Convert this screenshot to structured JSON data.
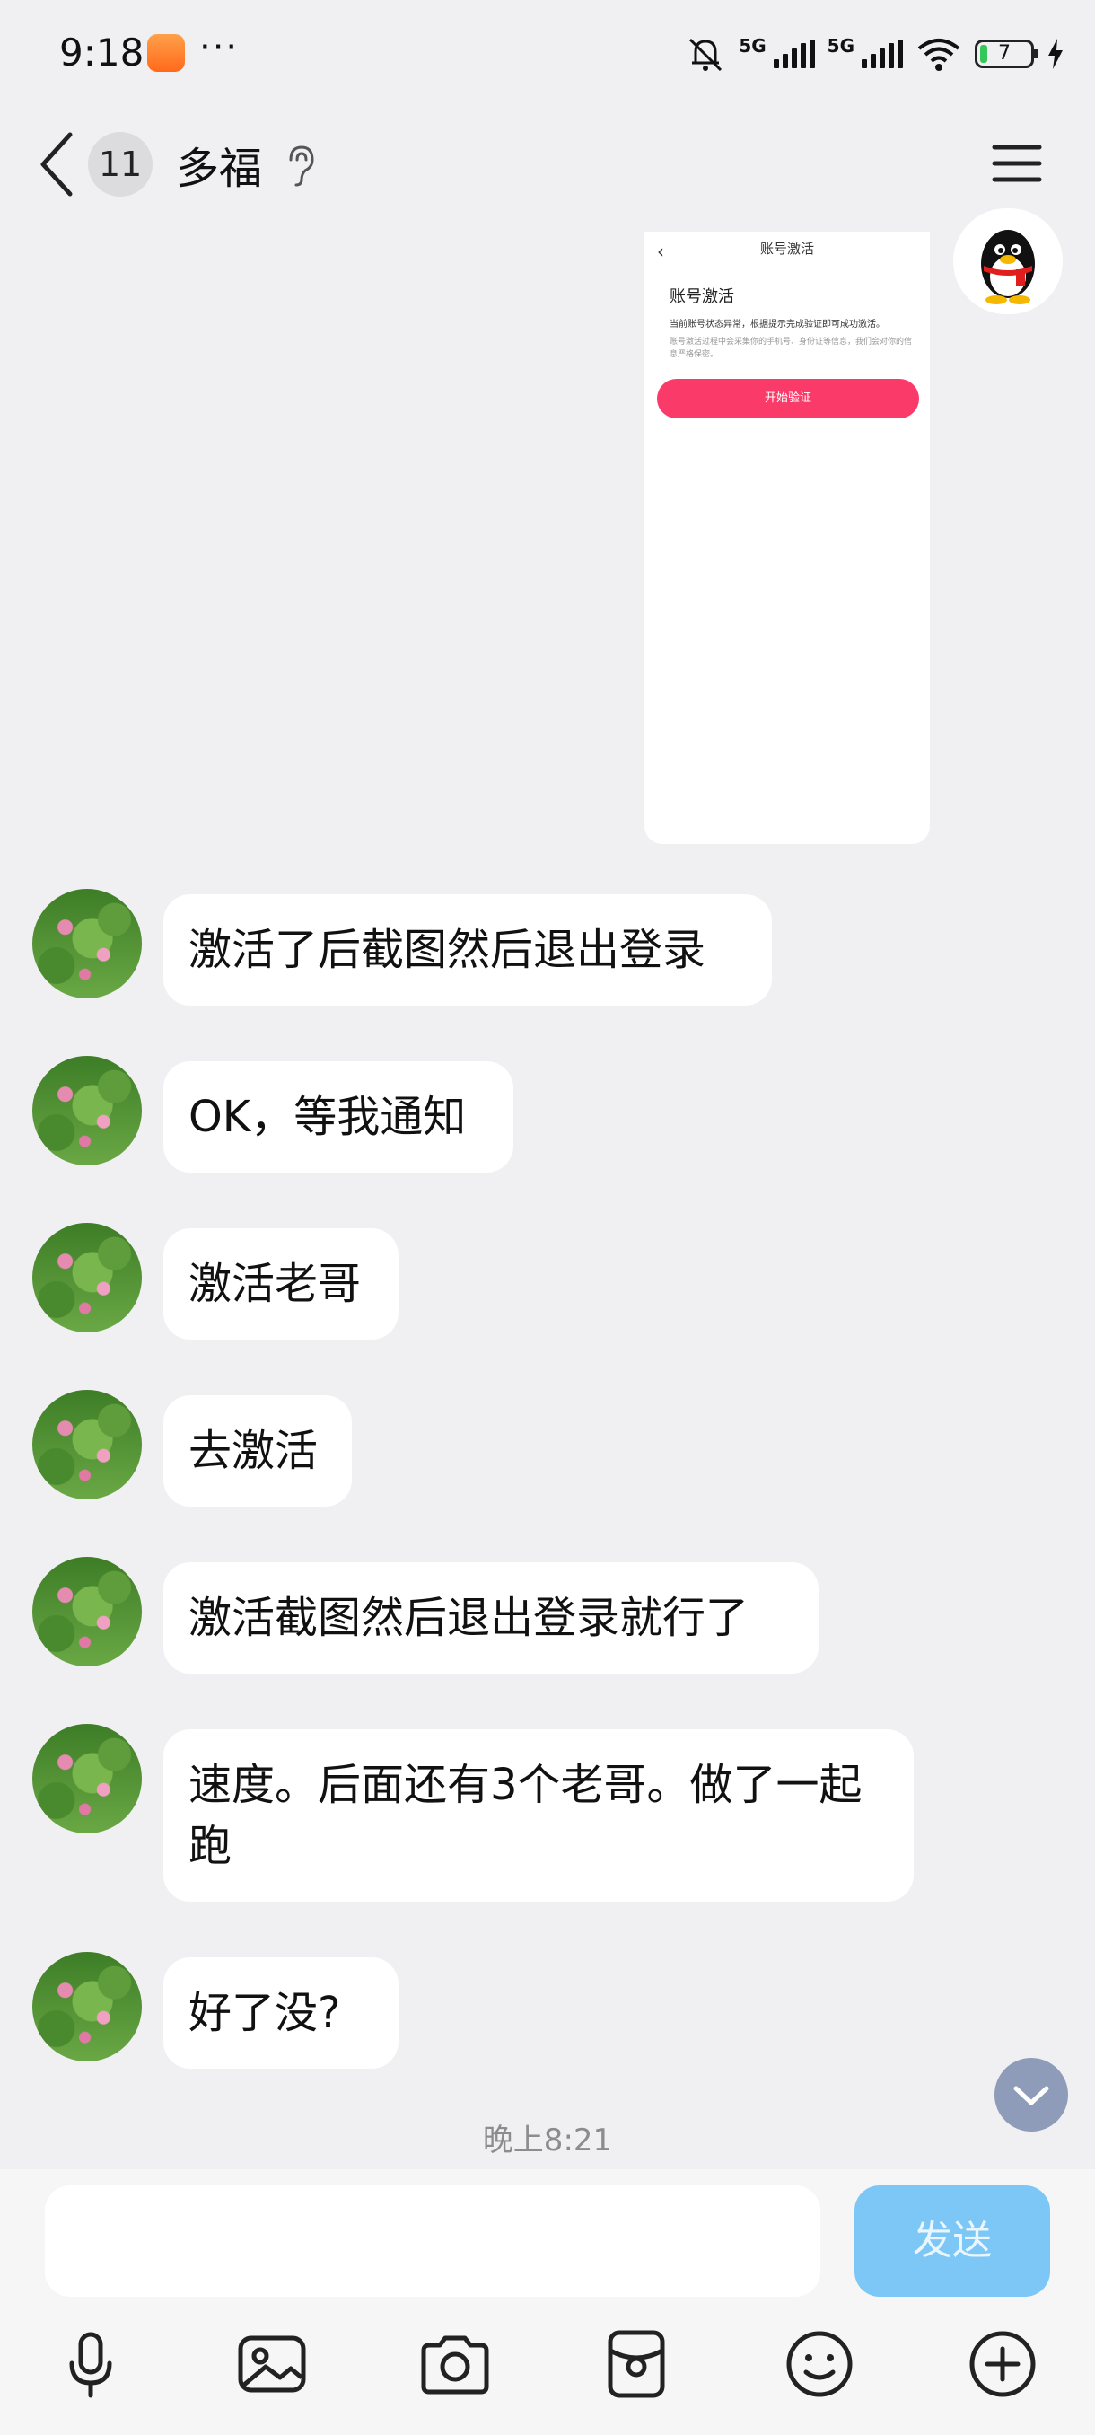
{
  "status_bar": {
    "time": "9:18",
    "more": "···",
    "network_1": "5G",
    "network_2": "5G",
    "battery_level": "7"
  },
  "header": {
    "unread_count": "11",
    "title": "多福"
  },
  "shared_screenshot": {
    "title": "账号激活",
    "heading": "账号激活",
    "line1": "当前账号状态异常，根据提示完成验证即可成功激活。",
    "line2": "账号激活过程中会采集你的手机号、身份证等信息，我们会对你的信息严格保密。",
    "button": "开始验证"
  },
  "messages": [
    {
      "text": "激活了后截图然后退出登录"
    },
    {
      "text": "OK，等我通知"
    },
    {
      "text": "激活老哥"
    },
    {
      "text": "去激活"
    },
    {
      "text": "激活截图然后退出登录就行了"
    },
    {
      "text": "速度。后面还有3个老哥。做了一起跑"
    },
    {
      "text": "好了没?"
    }
  ],
  "time_separator": "晚上8:21",
  "composer": {
    "placeholder": "",
    "send_label": "发送"
  },
  "colors": {
    "accent_pink": "#fa3b6a",
    "send_button": "#7cc7f6"
  },
  "toolbar_icons": [
    "microphone-icon",
    "image-icon",
    "camera-icon",
    "red-packet-icon",
    "emoji-icon",
    "plus-icon"
  ]
}
